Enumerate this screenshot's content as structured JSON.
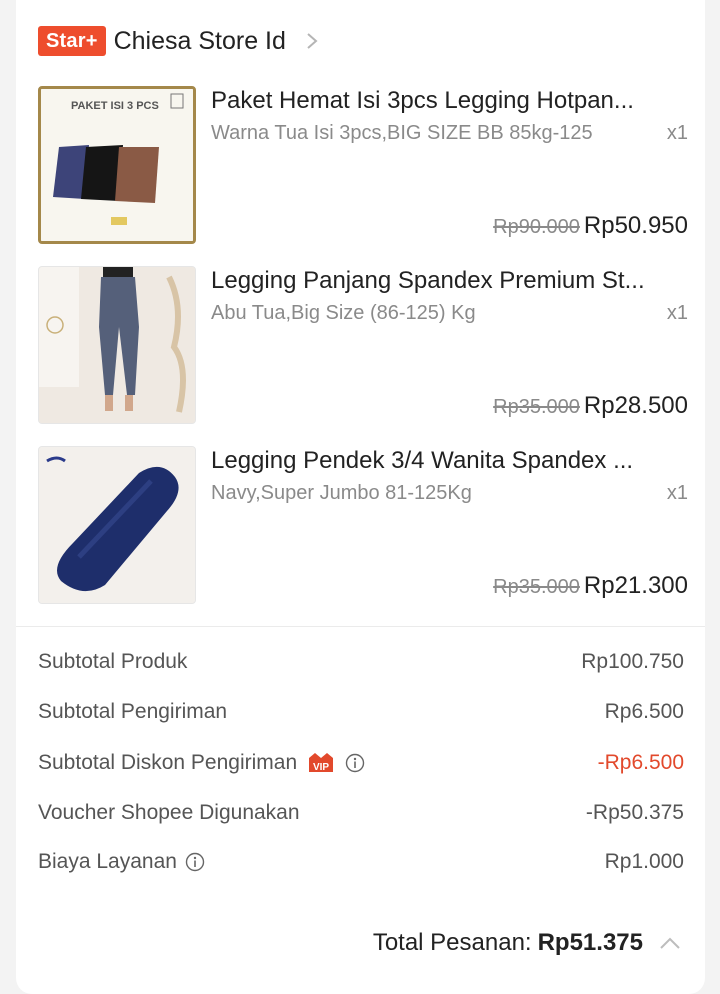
{
  "store": {
    "badge": "Star+",
    "name": "Chiesa Store Id"
  },
  "products": [
    {
      "title": "Paket Hemat Isi 3pcs Legging Hotpan...",
      "variant": "Warna Tua Isi 3pcs,BIG SIZE BB 85kg-125",
      "qty": "x1",
      "old_price": "Rp90.000",
      "price": "Rp50.950",
      "thumb_text": "PAKET ISI 3 PCS"
    },
    {
      "title": "Legging Panjang Spandex Premium St...",
      "variant": "Abu Tua,Big Size (86-125) Kg",
      "qty": "x1",
      "old_price": "Rp35.000",
      "price": "Rp28.500"
    },
    {
      "title": "Legging Pendek 3/4 Wanita Spandex ...",
      "variant": "Navy,Super Jumbo 81-125Kg",
      "qty": "x1",
      "old_price": "Rp35.000",
      "price": "Rp21.300"
    }
  ],
  "summary": {
    "subtotal_produk_label": "Subtotal Produk",
    "subtotal_produk_value": "Rp100.750",
    "subtotal_pengiriman_label": "Subtotal Pengiriman",
    "subtotal_pengiriman_value": "Rp6.500",
    "diskon_label": "Subtotal Diskon Pengiriman",
    "diskon_vip": "VIP",
    "diskon_value": "-Rp6.500",
    "voucher_label": "Voucher Shopee Digunakan",
    "voucher_value": "-Rp50.375",
    "biaya_label": "Biaya Layanan",
    "biaya_value": "Rp1.000"
  },
  "total": {
    "label": "Total Pesanan:",
    "value": "Rp51.375"
  },
  "colors": {
    "accent": "#ee4d2d",
    "discount": "#e2492c"
  }
}
